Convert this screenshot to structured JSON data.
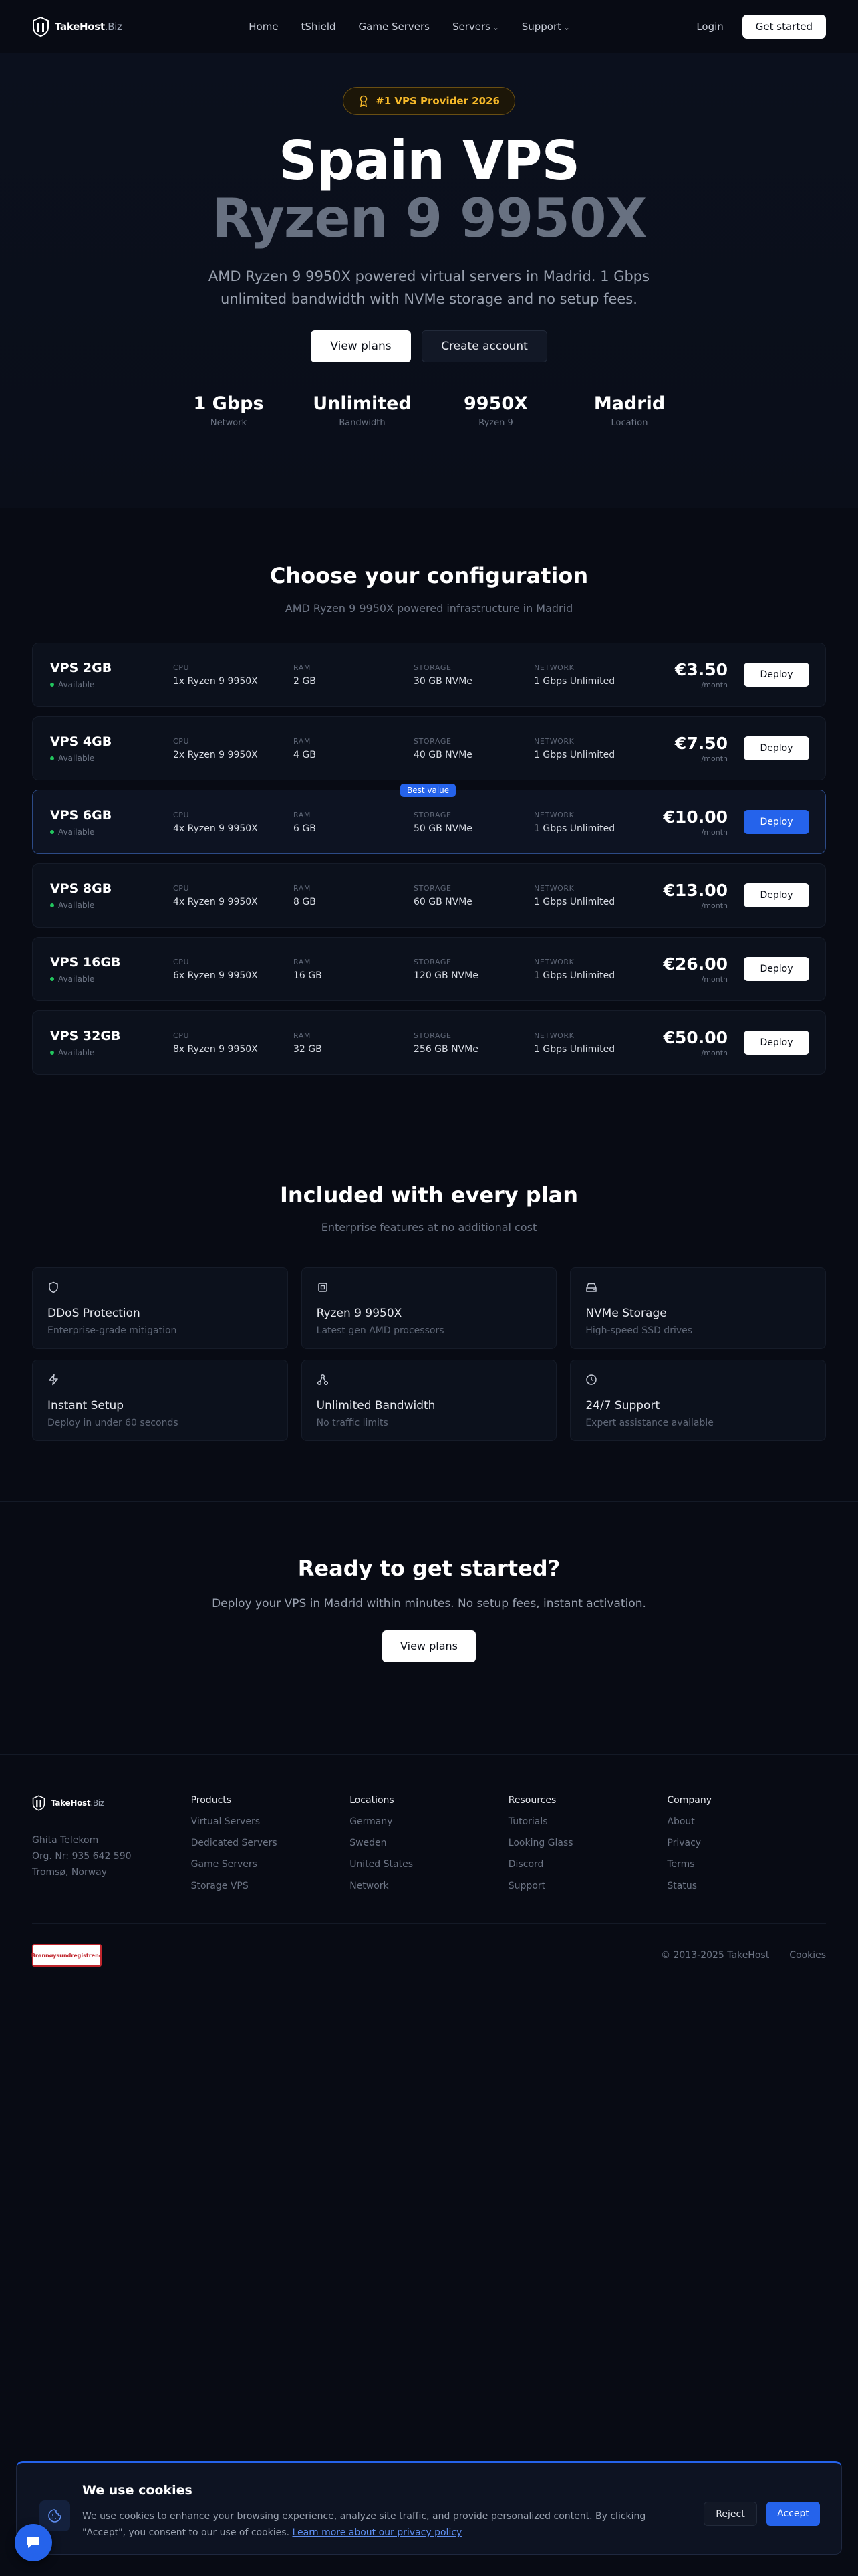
{
  "nav": {
    "logo": {
      "name": "TakeHost",
      "tld": ".Biz"
    },
    "links": [
      "Home",
      "tShield",
      "Game Servers",
      "Servers",
      "Support"
    ],
    "login": "Login",
    "cta": "Get started"
  },
  "hero": {
    "badge": "#1 VPS Provider 2026",
    "title_line1": "Spain VPS",
    "title_line2": "Ryzen 9 9950X",
    "subtitle": "AMD Ryzen 9 9950X powered virtual servers in Madrid. 1 Gbps unlimited bandwidth with NVMe storage and no setup fees.",
    "primary_button": "View plans",
    "secondary_button": "Create account",
    "stats": [
      {
        "value": "1 Gbps",
        "label": "Network"
      },
      {
        "value": "Unlimited",
        "label": "Bandwidth"
      },
      {
        "value": "9950X",
        "label": "Ryzen 9"
      },
      {
        "value": "Madrid",
        "label": "Location"
      }
    ]
  },
  "config": {
    "title": "Choose your configuration",
    "subtitle": "AMD Ryzen 9 9950X powered infrastructure in Madrid",
    "labels": {
      "cpu": "CPU",
      "ram": "RAM",
      "storage": "STORAGE",
      "network": "NETWORK",
      "per_month": "/month",
      "available": "Available",
      "best_value": "Best value",
      "deploy": "Deploy"
    },
    "plans": [
      {
        "name": "VPS 2GB",
        "cpu": "1x Ryzen 9 9950X",
        "ram": "2 GB",
        "storage": "30 GB NVMe",
        "network": "1 Gbps Unlimited",
        "price": "€3.50"
      },
      {
        "name": "VPS 4GB",
        "cpu": "2x Ryzen 9 9950X",
        "ram": "4 GB",
        "storage": "40 GB NVMe",
        "network": "1 Gbps Unlimited",
        "price": "€7.50"
      },
      {
        "name": "VPS 6GB",
        "cpu": "4x Ryzen 9 9950X",
        "ram": "6 GB",
        "storage": "50 GB NVMe",
        "network": "1 Gbps Unlimited",
        "price": "€10.00"
      },
      {
        "name": "VPS 8GB",
        "cpu": "4x Ryzen 9 9950X",
        "ram": "8 GB",
        "storage": "60 GB NVMe",
        "network": "1 Gbps Unlimited",
        "price": "€13.00"
      },
      {
        "name": "VPS 16GB",
        "cpu": "6x Ryzen 9 9950X",
        "ram": "16 GB",
        "storage": "120 GB NVMe",
        "network": "1 Gbps Unlimited",
        "price": "€26.00"
      },
      {
        "name": "VPS 32GB",
        "cpu": "8x Ryzen 9 9950X",
        "ram": "32 GB",
        "storage": "256 GB NVMe",
        "network": "1 Gbps Unlimited",
        "price": "€50.00"
      }
    ]
  },
  "features": {
    "title": "Included with every plan",
    "subtitle": "Enterprise features at no additional cost",
    "items": [
      {
        "icon": "shield-icon",
        "title": "DDoS Protection",
        "desc": "Enterprise-grade mitigation"
      },
      {
        "icon": "cpu-icon",
        "title": "Ryzen 9 9950X",
        "desc": "Latest gen AMD processors"
      },
      {
        "icon": "drive-icon",
        "title": "NVMe Storage",
        "desc": "High-speed SSD drives"
      },
      {
        "icon": "bolt-icon",
        "title": "Instant Setup",
        "desc": "Deploy in under 60 seconds"
      },
      {
        "icon": "network-icon",
        "title": "Unlimited Bandwidth",
        "desc": "No traffic limits"
      },
      {
        "icon": "clock-icon",
        "title": "24/7 Support",
        "desc": "Expert assistance available"
      }
    ]
  },
  "cta": {
    "title": "Ready to get started?",
    "subtitle": "Deploy your VPS in Madrid within minutes. No setup fees, instant activation.",
    "button": "View plans"
  },
  "footer": {
    "address": [
      "Ghita Telekom",
      "Org. Nr: 935 642 590",
      "Tromsø, Norway"
    ],
    "columns": [
      {
        "title": "Products",
        "links": [
          "Virtual Servers",
          "Dedicated Servers",
          "Game Servers",
          "Storage VPS"
        ]
      },
      {
        "title": "Locations",
        "links": [
          "Germany",
          "Sweden",
          "United States",
          "Network"
        ]
      },
      {
        "title": "Resources",
        "links": [
          "Tutorials",
          "Looking Glass",
          "Discord",
          "Support"
        ]
      },
      {
        "title": "Company",
        "links": [
          "About",
          "Privacy",
          "Terms",
          "Status"
        ]
      }
    ],
    "badge": "Brønnøysundregistrene",
    "copyright": "© 2013-2025 TakeHost",
    "cookies_link": "Cookies"
  },
  "cookie": {
    "title": "We use cookies",
    "text": "We use cookies to enhance your browsing experience, analyze site traffic, and provide personalized content. By clicking \"Accept\", you consent to our use of cookies.",
    "link": "Learn more about our privacy policy",
    "reject": "Reject",
    "accept": "Accept"
  },
  "colors": {
    "accent": "#2563eb",
    "badge": "#f5b829",
    "available": "#22c55e"
  }
}
